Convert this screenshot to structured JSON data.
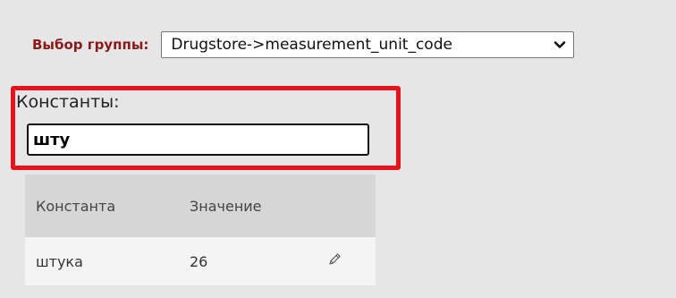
{
  "group_selector": {
    "label": "Выбор группы:",
    "selected_value": "Drugstore->measurement_unit_code"
  },
  "filter": {
    "label": "Константы:",
    "value": "шту",
    "highlight_color": "#e8121a"
  },
  "table": {
    "columns": [
      "Константа",
      "Значение",
      ""
    ],
    "rows": [
      {
        "constant": "штука",
        "value": "26",
        "action_icon": "pencil-icon"
      }
    ]
  }
}
